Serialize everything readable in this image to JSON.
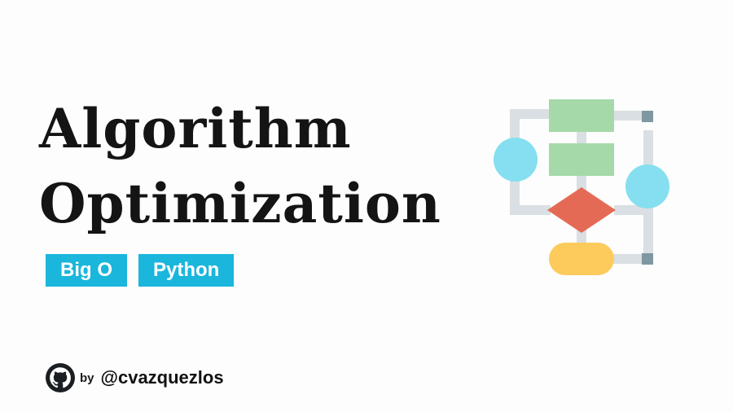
{
  "title": {
    "line1": "Algorithm",
    "line2": "Optimization"
  },
  "tags": [
    {
      "label": "Big O"
    },
    {
      "label": "Python"
    }
  ],
  "author": {
    "by": "by",
    "handle": "@cvazquezlos",
    "icon": "github-icon"
  },
  "illustration": {
    "icon": "flowchart-icon",
    "colors": {
      "line": "#d9dfe2",
      "process": "#a6d9a9",
      "terminal_circle": "#85dff0",
      "decision": "#e56a55",
      "end": "#fdcb5c",
      "connector": "#7f97a0"
    }
  },
  "colors": {
    "tag_background": "#1ab6dc",
    "tag_text": "#ffffff",
    "title_text": "#141414"
  }
}
